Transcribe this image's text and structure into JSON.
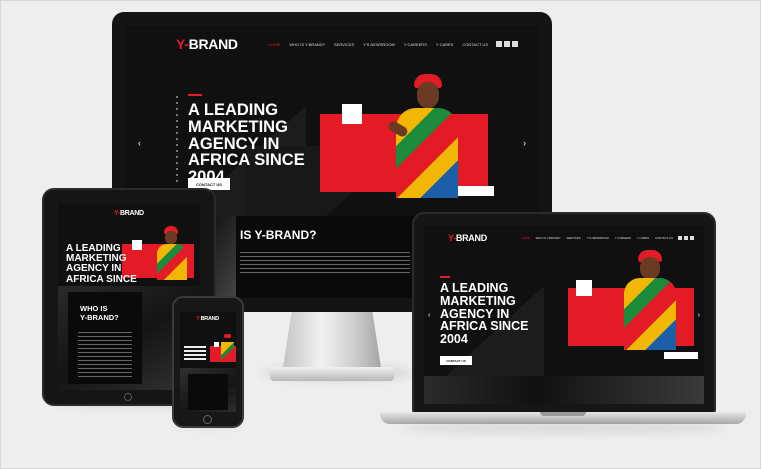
{
  "brand": {
    "logo_prefix": "Y-",
    "logo_main": "BRAND",
    "accent": "#e21b26"
  },
  "nav": {
    "items": [
      "HOME",
      "WHO IS Y-BRAND?",
      "SERVICES",
      "Y'S NEWSROOM",
      "Y CAREERS",
      "Y CARES",
      "CONTACT US"
    ]
  },
  "hero": {
    "headline_desktop": [
      "A LEADING",
      "MARKETING",
      "AGENCY IN",
      "AFRICA SINCE",
      "2004"
    ],
    "headline_tablet": [
      "A LEADING",
      "MARKETING",
      "AGENCY IN",
      "AFRICA SINCE"
    ],
    "cta": "CONTACT US"
  },
  "about": {
    "title_desktop": "IS Y-BRAND?",
    "title_tablet": [
      "WHO IS",
      "Y-BRAND?"
    ]
  },
  "colors": {
    "background": "#eeeeef",
    "screen": "#0d0d0d",
    "accent": "#e21b26"
  }
}
